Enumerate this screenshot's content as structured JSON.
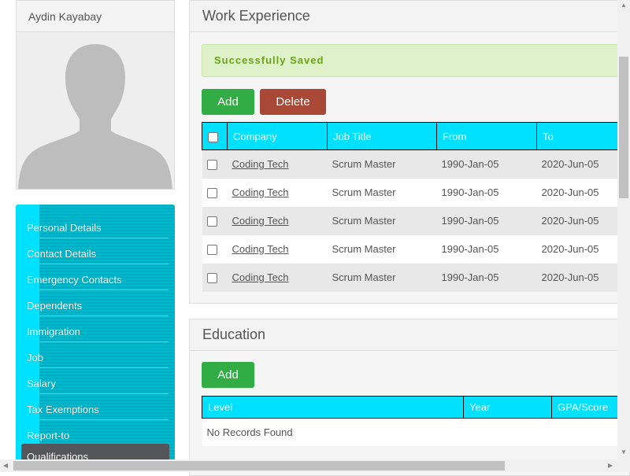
{
  "profile": {
    "name": "Aydin Kayabay"
  },
  "sidebar": {
    "items": [
      {
        "label": "Personal Details"
      },
      {
        "label": "Contact Details"
      },
      {
        "label": "Emergency Contacts"
      },
      {
        "label": "Dependents"
      },
      {
        "label": "Immigration"
      },
      {
        "label": "Job"
      },
      {
        "label": "Salary"
      },
      {
        "label": "Tax Exemptions"
      },
      {
        "label": "Report-to"
      },
      {
        "label": "Qualifications",
        "active": true
      }
    ]
  },
  "work": {
    "title": "Work Experience",
    "alert": "Successfully Saved",
    "add_label": "Add",
    "delete_label": "Delete",
    "columns": [
      "Company",
      "Job Title",
      "From",
      "To"
    ],
    "rows": [
      {
        "company": "Coding Tech",
        "title": "Scrum Master",
        "from": "1990-Jan-05",
        "to": "2020-Jun-05"
      },
      {
        "company": "Coding Tech",
        "title": "Scrum Master",
        "from": "1990-Jan-05",
        "to": "2020-Jun-05"
      },
      {
        "company": "Coding Tech",
        "title": "Scrum Master",
        "from": "1990-Jan-05",
        "to": "2020-Jun-05"
      },
      {
        "company": "Coding Tech",
        "title": "Scrum Master",
        "from": "1990-Jan-05",
        "to": "2020-Jun-05"
      },
      {
        "company": "Coding Tech",
        "title": "Scrum Master",
        "from": "1990-Jan-05",
        "to": "2020-Jun-05"
      }
    ]
  },
  "education": {
    "title": "Education",
    "add_label": "Add",
    "columns": [
      "Level",
      "Year",
      "GPA/Score"
    ],
    "empty": "No Records Found"
  },
  "colors": {
    "accent": "#00e1ff",
    "add": "#32ad45",
    "delete": "#a94837",
    "active_nav": "#555659"
  }
}
